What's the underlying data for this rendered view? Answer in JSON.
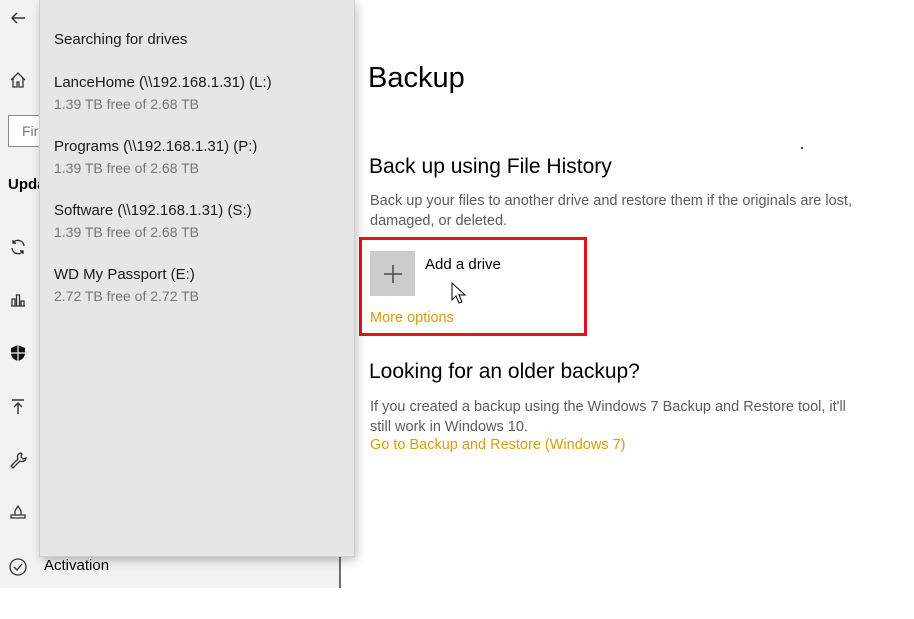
{
  "nav": {
    "search_placeholder_fragment": "Fir",
    "section_fragment": "Upda",
    "activation_label": "Activation",
    "icons": [
      "back-arrow-icon",
      "home-icon",
      "sync-icon",
      "delivery-optimization-icon",
      "shield-icon",
      "backup-arrow-icon",
      "troubleshoot-wrench-icon",
      "recovery-icon",
      "activation-check-icon"
    ]
  },
  "flyout": {
    "title": "Searching for drives",
    "drives": [
      {
        "name": "LanceHome (\\\\192.168.1.31) (L:)",
        "free": "1.39 TB free of 2.68 TB"
      },
      {
        "name": "Programs (\\\\192.168.1.31) (P:)",
        "free": "1.39 TB free of 2.68 TB"
      },
      {
        "name": "Software (\\\\192.168.1.31) (S:)",
        "free": "1.39 TB free of 2.68 TB"
      },
      {
        "name": "WD My Passport (E:)",
        "free": "2.72 TB free of 2.72 TB"
      }
    ]
  },
  "main": {
    "title": "Backup",
    "file_history": {
      "heading": "Back up using File History",
      "description": "Back up your files to another drive and restore them if the originals are lost, damaged, or deleted.",
      "add_drive_label": "Add a drive",
      "more_options": "More options"
    },
    "older_backup": {
      "heading": "Looking for an older backup?",
      "description": "If you created a backup using the Windows 7 Backup and Restore tool, it'll still work in Windows 10.",
      "link": "Go to Backup and Restore (Windows 7)"
    }
  },
  "colors": {
    "accent_link": "#d69e0a",
    "highlight_box": "#e5141b",
    "flyout_bg": "#e6e6e6",
    "add_tile_bg": "#cccccc"
  }
}
